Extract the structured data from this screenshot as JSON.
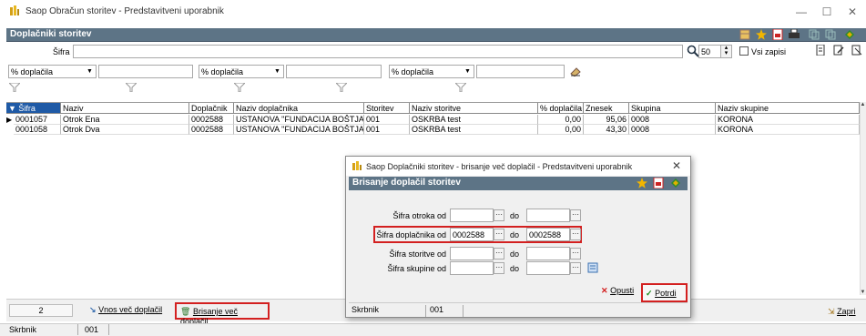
{
  "window": {
    "title": "Saop Obračun storitev - Predstavitveni uporabnik",
    "minimize": "—",
    "maximize": "☐",
    "close": "✕"
  },
  "header": {
    "title": "Doplačniki storitev"
  },
  "search": {
    "sifra_label": "Šifra",
    "sifra_value": "",
    "count_value": "50",
    "vsi_zapisi_label": "Vsi zapisi",
    "vsi_zapisi_checked": false
  },
  "filters": [
    {
      "selected": "% doplačila",
      "value": ""
    },
    {
      "selected": "% doplačila",
      "value": ""
    },
    {
      "selected": "% doplačila",
      "value": ""
    }
  ],
  "grid": {
    "columns": [
      "▼ Šifra",
      "Naziv",
      "Doplačnik",
      "Naziv doplačnika",
      "Storitev",
      "Naziv storitve",
      "% doplačila",
      "Znesek",
      "Skupina",
      "Naziv skupine"
    ],
    "rows": [
      [
        "0001057",
        "Otrok Ena",
        "0002588",
        "USTANOVA \"FUNDACIJA BOŠTJANA",
        "001",
        "OSKRBA test",
        "0,00",
        "95,06",
        "0008",
        "KORONA"
      ],
      [
        "0001058",
        "Otrok Dva",
        "0002588",
        "USTANOVA \"FUNDACIJA BOŠTJANA",
        "001",
        "OSKRBA test",
        "0,00",
        "43,30",
        "0008",
        "KORONA"
      ]
    ]
  },
  "bottom": {
    "record_count": "2",
    "vnos_label": "Vnos več doplačil",
    "brisanje_label": "Brisanje več doplačil",
    "zapri_label": "Zapri"
  },
  "status": {
    "field": "Skrbnik",
    "value": "001"
  },
  "dialog": {
    "title": "Saop Doplačniki storitev - brisanje več doplačil - Predstavitveni uporabnik",
    "close": "✕",
    "header": "Brisanje doplačil storitev",
    "do_label": "do",
    "fields": [
      {
        "label": "Šifra otroka od",
        "from": "",
        "to": ""
      },
      {
        "label": "Šifra doplačnika od",
        "from": "0002588",
        "to": "0002588"
      },
      {
        "label": "Šifra storitve od",
        "from": "",
        "to": ""
      },
      {
        "label": "Šifra skupine od",
        "from": "",
        "to": ""
      }
    ],
    "opusti_label": "Opusti",
    "potrdi_label": "Potrdi",
    "status_field": "Skrbnik",
    "status_value": "001"
  },
  "colors": {
    "header_band": "#5d7486",
    "selected_header": "#1f5aa6",
    "highlight": "#d32020"
  }
}
